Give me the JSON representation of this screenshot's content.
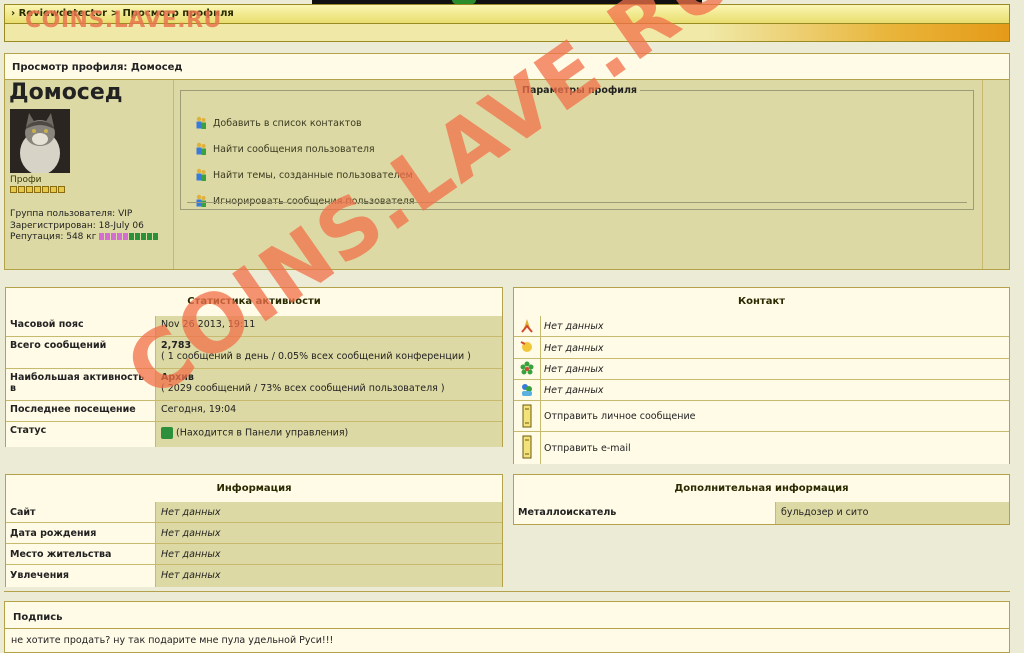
{
  "nav": {
    "site": "Reviewdetector",
    "sep": ">",
    "page": "Просмотр профиля"
  },
  "watermark": {
    "top": "COINS.LAVE.RU",
    "diagonal": "COINS.LAVE.RU"
  },
  "profile": {
    "header": "Просмотр профиля: Домосед",
    "username": "Домосед",
    "rank": "Профи",
    "group": "Группа пользователя: VIP",
    "registered": "Зарегистрирован: 18-July 06",
    "reputation": "Репутация: 548 кг",
    "params_title": "Параметры профиля",
    "actions": [
      "Добавить в список контактов",
      "Найти сообщения пользователя",
      "Найти темы, созданные пользователем",
      "Игнорировать сообщения пользователя"
    ]
  },
  "stats": {
    "title": "Статистика активности",
    "rows": [
      {
        "label": "Часовой пояс",
        "value": "Nov 26 2013, 19:11",
        "sub": ""
      },
      {
        "label": "Всего сообщений",
        "value": "2,783",
        "sub": "( 1 сообщений в день / 0.05% всех сообщений конференции )"
      },
      {
        "label": "Наибольшая активность в",
        "value": "Архив",
        "sub": "( 2029 сообщений / 73% всех сообщений пользователя )"
      },
      {
        "label": "Последнее посещение",
        "value": "Сегодня, 19:04",
        "sub": ""
      },
      {
        "label": "Статус",
        "value": "(Находится в Панели управления)",
        "sub": ""
      }
    ]
  },
  "contact": {
    "title": "Контакт",
    "rows": [
      {
        "icon": "aim-icon",
        "value": "Нет данных"
      },
      {
        "icon": "yahoo-icon",
        "value": "Нет данных"
      },
      {
        "icon": "icq-icon",
        "value": "Нет данных"
      },
      {
        "icon": "msn-icon",
        "value": "Нет данных"
      },
      {
        "icon": "pm-icon",
        "value": "Отправить личное сообщение"
      },
      {
        "icon": "email-icon",
        "value": "Отправить e-mail"
      }
    ]
  },
  "info": {
    "title": "Информация",
    "rows": [
      {
        "label": "Сайт",
        "value": "Нет данных"
      },
      {
        "label": "Дата рождения",
        "value": "Нет данных"
      },
      {
        "label": "Место жительства",
        "value": "Нет данных"
      },
      {
        "label": "Увлечения",
        "value": "Нет данных"
      }
    ]
  },
  "extra": {
    "title": "Дополнительная информация",
    "rows": [
      {
        "label": "Металлоискатель",
        "value": "бульдозер и сито"
      }
    ]
  },
  "signature": {
    "title": "Подпись",
    "text": "не хотите продать? ну так подарите мне пула удельной Руси!!!"
  }
}
